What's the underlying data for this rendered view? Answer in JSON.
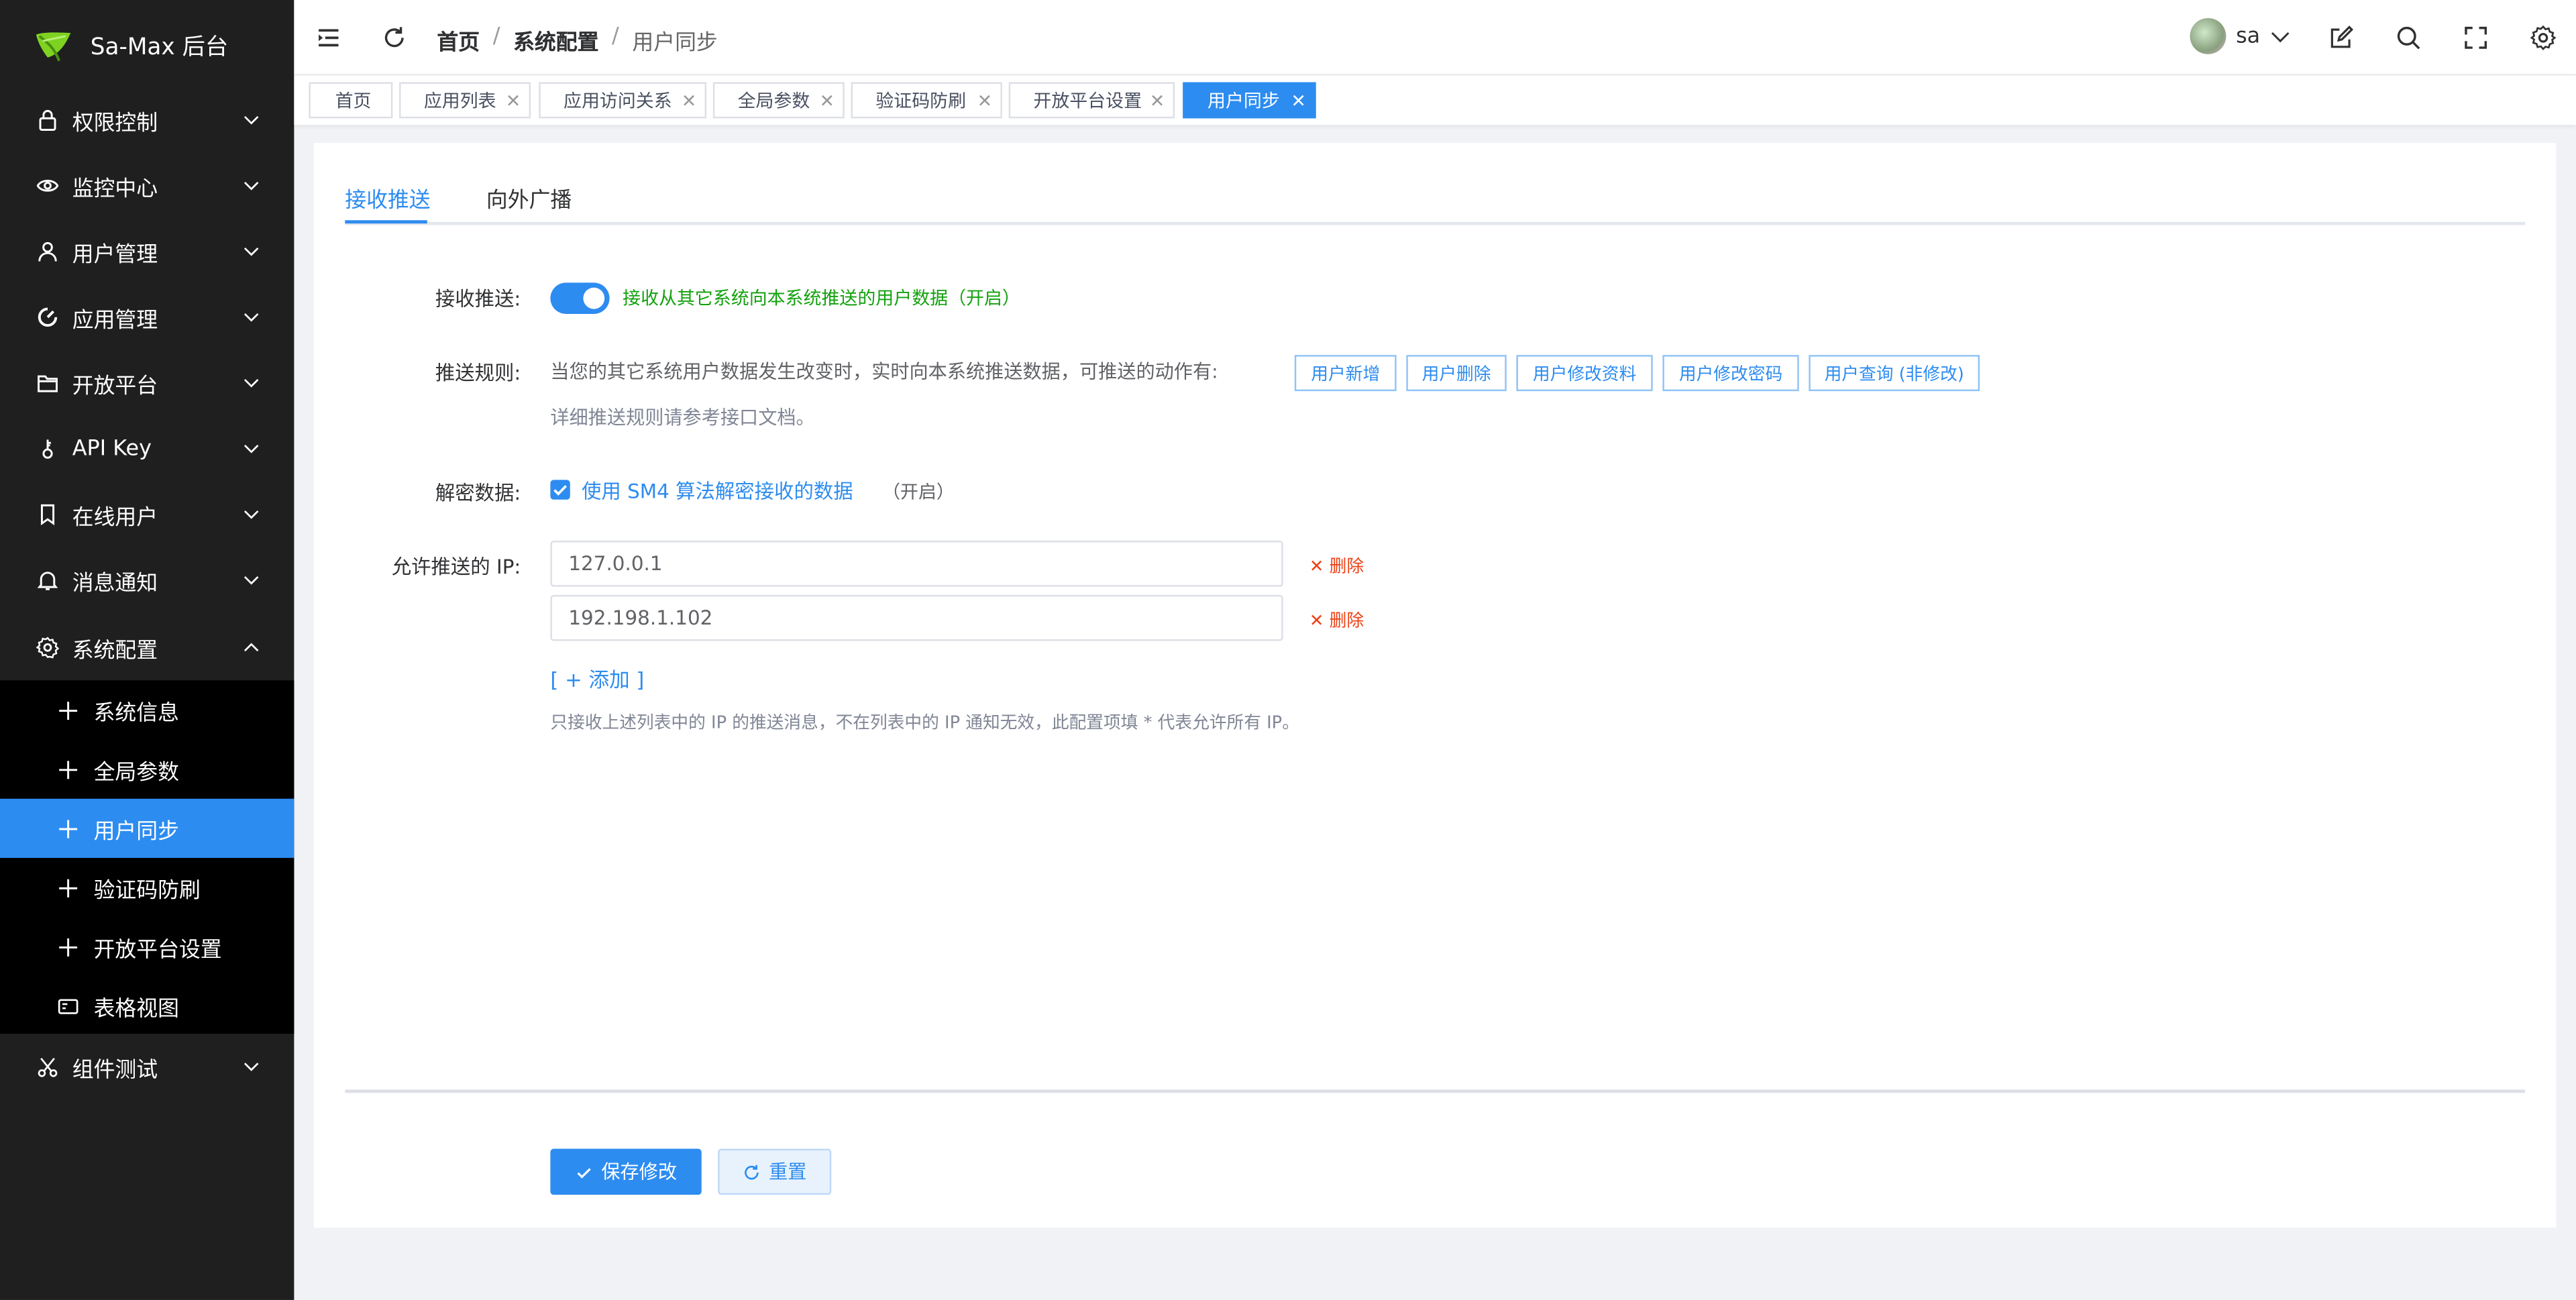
{
  "app": {
    "title": "Sa-Max 后台"
  },
  "sidebar": {
    "items": [
      {
        "label": "权限控制",
        "icon": "lock-icon"
      },
      {
        "label": "监控中心",
        "icon": "eye-icon"
      },
      {
        "label": "用户管理",
        "icon": "user-icon"
      },
      {
        "label": "应用管理",
        "icon": "gauge-icon"
      },
      {
        "label": "开放平台",
        "icon": "folder-icon"
      },
      {
        "label": "API Key",
        "icon": "key-icon"
      },
      {
        "label": "在线用户",
        "icon": "bookmark-icon"
      },
      {
        "label": "消息通知",
        "icon": "bell-icon"
      },
      {
        "label": "系统配置",
        "icon": "gear-icon"
      },
      {
        "label": "组件测试",
        "icon": "scissors-icon"
      }
    ],
    "subitems": [
      {
        "label": "系统信息",
        "icon": "plus-icon"
      },
      {
        "label": "全局参数",
        "icon": "plus-icon"
      },
      {
        "label": "用户同步",
        "icon": "plus-icon"
      },
      {
        "label": "验证码防刷",
        "icon": "plus-icon"
      },
      {
        "label": "开放平台设置",
        "icon": "plus-icon"
      },
      {
        "label": "表格视图",
        "icon": "table-view-icon"
      }
    ]
  },
  "header": {
    "breadcrumb": [
      "首页",
      "/",
      "系统配置",
      "/",
      "用户同步"
    ],
    "user": "sa"
  },
  "tabs": [
    "首页",
    "应用列表",
    "应用访问关系",
    "全局参数",
    "验证码防刷",
    "开放平台设置",
    "用户同步"
  ],
  "page": {
    "tabs": [
      "接收推送",
      "向外广播"
    ],
    "receive": {
      "label": "接收推送:",
      "switch_text": "接收从其它系统向本系统推送的用户数据（开启）"
    },
    "rules": {
      "label": "推送规则:",
      "text": "当您的其它系统用户数据发生改变时，实时向本系统推送数据，可推送的动作有:",
      "actions": [
        "用户新增",
        "用户删除",
        "用户修改资料",
        "用户修改密码",
        "用户查询 (非修改)"
      ],
      "doc": "详细推送规则请参考接口文档。"
    },
    "decrypt": {
      "label": "解密数据:",
      "checkbox": "使用 SM4 算法解密接收的数据",
      "note": "（开启）"
    },
    "ips": {
      "label": "允许推送的 IP:",
      "values": [
        "127.0.0.1",
        "192.198.1.102"
      ],
      "delete_label": "删除",
      "add_label": "[ + 添加 ]",
      "hint": "只接收上述列表中的 IP 的推送消息，不在列表中的 IP 通知无效，此配置项填 * 代表允许所有 IP。"
    },
    "buttons": {
      "save": "保存修改",
      "reset": "重置"
    }
  },
  "colors": {
    "accent": "#2d8cf0",
    "sidebar": "#1f1f1f",
    "submenu": "#000000",
    "success": "#13a10e",
    "danger": "#ed4014"
  }
}
